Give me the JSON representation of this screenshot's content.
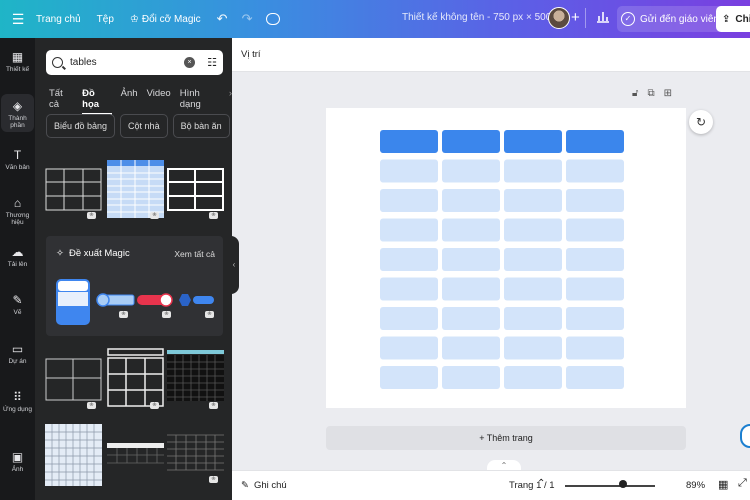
{
  "topbar": {
    "menu_icon": "hamburger-icon",
    "home": "Trang chủ",
    "file": "Tệp",
    "resize": "Đổi cỡ Magic",
    "document_title": "Thiết kế không tên - 750 px × 500 px",
    "send_to_teacher": "Gửi đến giáo viên",
    "share": "Chi"
  },
  "rail": [
    {
      "label": "Thiết kế",
      "icon": "layout-icon"
    },
    {
      "label": "Thành phần",
      "icon": "elements-icon"
    },
    {
      "label": "Văn bản",
      "icon": "text-icon"
    },
    {
      "label": "Thương hiệu",
      "icon": "brand-icon"
    },
    {
      "label": "Tải lên",
      "icon": "upload-icon"
    },
    {
      "label": "Vẽ",
      "icon": "draw-icon"
    },
    {
      "label": "Dự án",
      "icon": "folder-icon"
    },
    {
      "label": "Ứng dụng",
      "icon": "apps-icon"
    },
    {
      "label": "Ảnh",
      "icon": "photo-icon"
    }
  ],
  "panel": {
    "search_value": "tables",
    "tabs": [
      "Tất cả",
      "Đồ họa",
      "Ảnh",
      "Video",
      "Hình dạng"
    ],
    "active_tab": "Đồ họa",
    "chips": [
      "Biểu đồ bảng",
      "Cột nhà",
      "Bộ bàn ăn"
    ],
    "magic_title": "Đề xuất Magic",
    "magic_see_all": "Xem tất cả"
  },
  "editor": {
    "position_label": "Vị trí",
    "add_page": "+ Thêm trang",
    "notes": "Ghi chú",
    "pager": "Trang 1 / 1",
    "zoom": "89%",
    "zoom_fraction": 0.64
  },
  "canvas_table": {
    "columns": 4,
    "rows": 9,
    "header_color": "#3b86ec",
    "cell_color": "#d3e4fa"
  }
}
